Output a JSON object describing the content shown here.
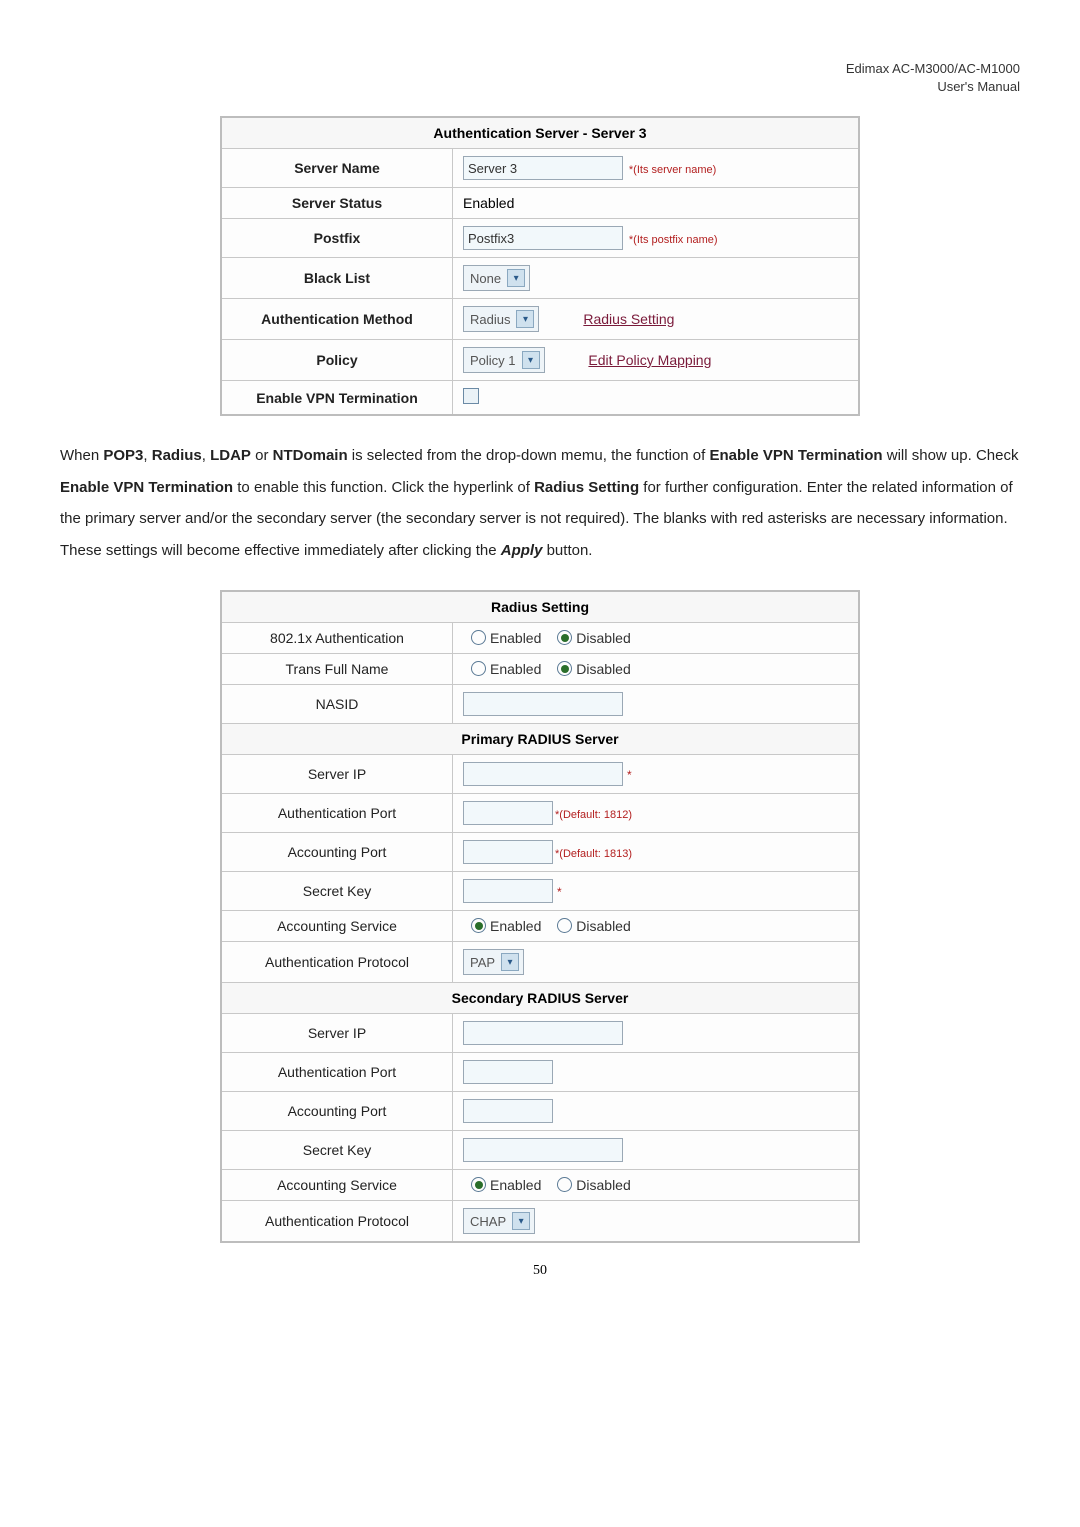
{
  "header": {
    "line1": "Edimax AC-M3000/AC-M1000",
    "line2": "User's Manual"
  },
  "auth_table": {
    "title": "Authentication Server - Server 3",
    "rows": {
      "server_name": {
        "label": "Server Name",
        "value": "Server 3",
        "hint": "*(Its server name)"
      },
      "server_status": {
        "label": "Server Status",
        "value": "Enabled"
      },
      "postfix": {
        "label": "Postfix",
        "value": "Postfix3",
        "hint": "*(Its postfix name)"
      },
      "black_list": {
        "label": "Black List",
        "value": "None"
      },
      "auth_method": {
        "label": "Authentication Method",
        "value": "Radius",
        "link": "Radius Setting"
      },
      "policy": {
        "label": "Policy",
        "value": "Policy 1",
        "link": "Edit Policy Mapping"
      },
      "enable_vpn": {
        "label": "Enable VPN Termination"
      }
    }
  },
  "paragraph": {
    "t1": "When ",
    "b1": "POP3",
    "t2": ", ",
    "b2": "Radius",
    "t3": ", ",
    "b3": "LDAP",
    "t4": " or ",
    "b4": "NTDomain",
    "t5": " is selected from the drop-down memu, the function of ",
    "b5": "Enable VPN Termination",
    "t6": " will show up. Check ",
    "b6": "Enable VPN Termination",
    "t7": " to enable this function. Click the hyperlink of ",
    "b7": "Radius Setting",
    "t8": " for further configuration. Enter the related information of the primary server and/or the secondary server (the secondary server is not required). The blanks with red asterisks are necessary information. These settings will become effective immediately after clicking the ",
    "bi1": "Apply",
    "t9": " button."
  },
  "radius_table": {
    "title": "Radius Setting",
    "rows": {
      "auth_8021x": {
        "label": "802.1x Authentication",
        "opt_enabled": "Enabled",
        "opt_disabled": "Disabled",
        "selected": "disabled"
      },
      "trans_name": {
        "label": "Trans Full Name",
        "opt_enabled": "Enabled",
        "opt_disabled": "Disabled",
        "selected": "disabled"
      },
      "nasid": {
        "label": "NASID",
        "value": ""
      }
    },
    "primary": {
      "title": "Primary RADIUS Server",
      "server_ip": {
        "label": "Server IP",
        "value": "",
        "hint": "*"
      },
      "auth_port": {
        "label": "Authentication Port",
        "value": "",
        "hint": "*(Default: 1812)"
      },
      "acct_port": {
        "label": "Accounting Port",
        "value": "",
        "hint": "*(Default: 1813)"
      },
      "secret_key": {
        "label": "Secret Key",
        "value": "",
        "hint": "*"
      },
      "acct_service": {
        "label": "Accounting Service",
        "opt_enabled": "Enabled",
        "opt_disabled": "Disabled",
        "selected": "enabled"
      },
      "auth_proto": {
        "label": "Authentication Protocol",
        "value": "PAP"
      }
    },
    "secondary": {
      "title": "Secondary RADIUS Server",
      "server_ip": {
        "label": "Server IP",
        "value": ""
      },
      "auth_port": {
        "label": "Authentication Port",
        "value": ""
      },
      "acct_port": {
        "label": "Accounting Port",
        "value": ""
      },
      "secret_key": {
        "label": "Secret Key",
        "value": ""
      },
      "acct_service": {
        "label": "Accounting Service",
        "opt_enabled": "Enabled",
        "opt_disabled": "Disabled",
        "selected": "enabled"
      },
      "auth_proto": {
        "label": "Authentication Protocol",
        "value": "CHAP"
      }
    }
  },
  "page_number": "50"
}
